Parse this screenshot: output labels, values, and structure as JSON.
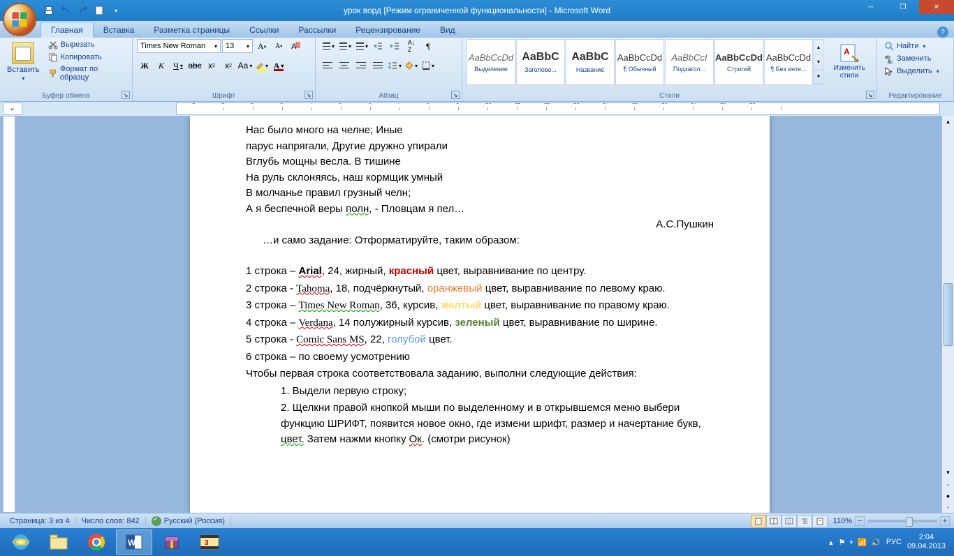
{
  "titlebar": {
    "title": "урок ворд [Режим ограниченной функциональности] - Microsoft Word"
  },
  "tabs": {
    "home": "Главная",
    "insert": "Вставка",
    "layout": "Разметка страницы",
    "refs": "Ссылки",
    "mail": "Рассылки",
    "review": "Рецензирование",
    "view": "Вид"
  },
  "clipboard": {
    "group": "Буфер обмена",
    "paste": "Вставить",
    "cut": "Вырезать",
    "copy": "Копировать",
    "painter": "Формат по образцу"
  },
  "font": {
    "group": "Шрифт",
    "name": "Times New Roman",
    "size": "13"
  },
  "para": {
    "group": "Абзац"
  },
  "styles": {
    "group": "Стили",
    "items": [
      {
        "preview": "AaBbCcDd",
        "name": "Выделение"
      },
      {
        "preview": "AaBbC",
        "name": "Заголово..."
      },
      {
        "preview": "AaBbC",
        "name": "Название"
      },
      {
        "preview": "AaBbCcDd",
        "name": "¶ Обычный"
      },
      {
        "preview": "AaBbCcI",
        "name": "Подзагол..."
      },
      {
        "preview": "AaBbCcDd",
        "name": "Строгий"
      },
      {
        "preview": "AaBbCcDd",
        "name": "¶ Без инте..."
      }
    ],
    "change": "Изменить стили"
  },
  "editing": {
    "group": "Редактирование",
    "find": "Найти",
    "replace": "Заменить",
    "select": "Выделить"
  },
  "doc": {
    "poem": [
      "Нас было много на челне; Иные",
      "парус напрягали, Другие дружно упирали",
      "Вглубь мощны весла. В тишине",
      "На руль склоняясь, наш кормщик умный",
      "В молчанье правил грузный челн;",
      "А я беспечной веры полн,  - Пловцам я пел…"
    ],
    "author": "А.С.Пушкин",
    "task_intro": "…и само задание: Отформатируйте, таким образом:",
    "line1_a": "1 строка – ",
    "line1_font": "Arial",
    "line1_b": ", 24, жирный, ",
    "line1_color": "красный",
    "line1_c": " цвет,  выравнивание по центру.",
    "line2_a": "2 строка - ",
    "line2_font": "Tahoma",
    "line2_b": ", 18, подчёркнутый, ",
    "line2_color": "оранжевый",
    "line2_c": " цвет, выравнивание по левому краю.",
    "line3_a": "3 строка – ",
    "line3_font": "Times New Roman",
    "line3_b": ", 36, курсив, ",
    "line3_color": "желтый",
    "line3_c": " цвет,  выравнивание по правому краю.",
    "line4_a": "4 строка – ",
    "line4_font": "Verdana",
    "line4_b": ", 14 полужирный курсив, ",
    "line4_color": "зеленый",
    "line4_c": " цвет,  выравнивание по ширине.",
    "line5_a": "5 строка - ",
    "line5_font": "Comic Sans MS",
    "line5_b": ", 22,  ",
    "line5_color": "голубой",
    "line5_c": " цвет.",
    "line6": "6 строка – по своему усмотрению",
    "instr_head": "Чтобы первая строка соответствовала заданию, выполни следующие действия:",
    "instr1": "1.  Выдели первую строку;",
    "instr2": "2.  Щелкни правой кнопкой мыши по выделенному и в открывшемся меню выбери функцию ШРИФТ, появится новое окно, где измени шрифт, размер и начертание букв, цвет. Затем нажми кнопку Ок. (смотри рисунок)"
  },
  "statusbar": {
    "page": "Страница: 3 из 4",
    "words": "Число слов: 842",
    "lang": "Русский (Россия)",
    "zoom": "110%"
  },
  "taskbar": {
    "lang": "РУС",
    "time": "2:04",
    "date": "09.04.2013"
  }
}
